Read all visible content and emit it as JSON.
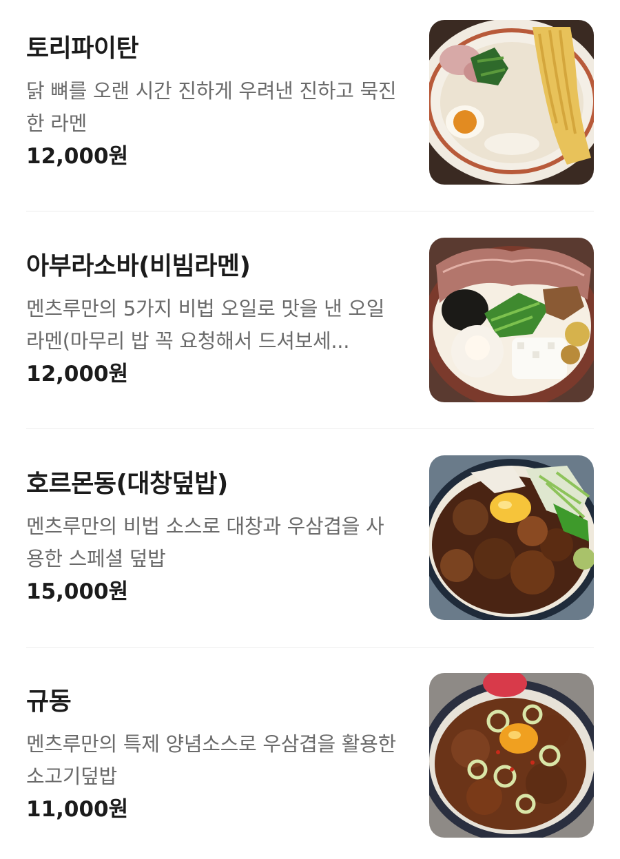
{
  "currency_suffix": "원",
  "menu": {
    "items": [
      {
        "name": "토리파이탄",
        "description": "닭 뼈를 오랜 시간 진하게 우려낸 진하고 묵진한 라멘",
        "price": "12,000원",
        "photo_icon": "chicken-paitan-ramen-photo"
      },
      {
        "name": "아부라소바(비빔라멘)",
        "description": "멘츠루만의 5가지 비법 오일로 맛을 낸 오일라멘(마무리 밥 꼭 요청해서 드셔보세...",
        "price": "12,000원",
        "photo_icon": "abura-soba-photo"
      },
      {
        "name": "호르몬동(대창덮밥)",
        "description": "멘츠루만의 비법 소스로 대창과 우삼겹을 사용한 스페셜 덮밥",
        "price": "15,000원",
        "photo_icon": "horumon-don-photo"
      },
      {
        "name": "규동",
        "description": "멘츠루만의 특제 양념소스로 우삼겹을 활용한 소고기덮밥",
        "price": "11,000원",
        "photo_icon": "gyudon-photo"
      }
    ]
  }
}
